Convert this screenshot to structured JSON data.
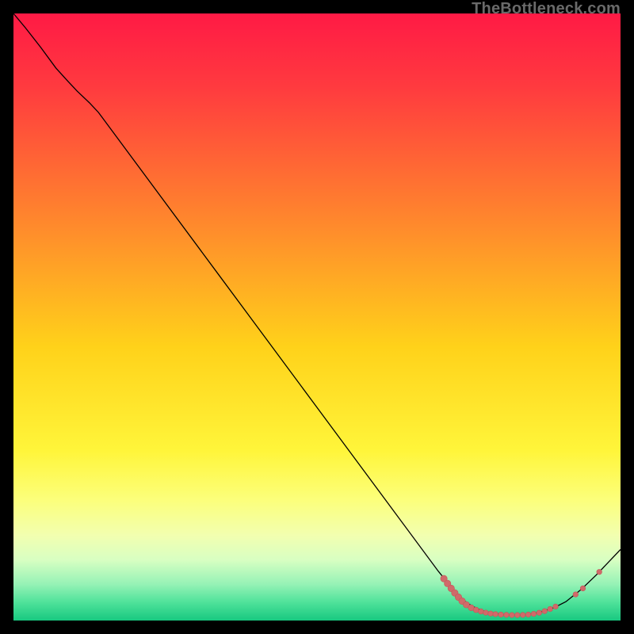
{
  "watermark": "TheBottleneck.com",
  "chart_data": {
    "type": "line",
    "title": "",
    "xlabel": "",
    "ylabel": "",
    "xlim": [
      0,
      100
    ],
    "ylim": [
      0,
      100
    ],
    "background_gradient": {
      "stops": [
        {
          "offset": 0.0,
          "color": "#ff1a45"
        },
        {
          "offset": 0.12,
          "color": "#ff3a3f"
        },
        {
          "offset": 0.35,
          "color": "#ff8a2c"
        },
        {
          "offset": 0.55,
          "color": "#ffd21a"
        },
        {
          "offset": 0.72,
          "color": "#fff53a"
        },
        {
          "offset": 0.8,
          "color": "#fcff7a"
        },
        {
          "offset": 0.86,
          "color": "#f2ffb0"
        },
        {
          "offset": 0.9,
          "color": "#d8ffc2"
        },
        {
          "offset": 0.94,
          "color": "#96f2b6"
        },
        {
          "offset": 0.97,
          "color": "#4fe29a"
        },
        {
          "offset": 1.0,
          "color": "#18c880"
        }
      ]
    },
    "series": [
      {
        "name": "curve",
        "color": "#000000",
        "width": 1.3,
        "points": [
          {
            "x": 0.0,
            "y": 100.0
          },
          {
            "x": 2.0,
            "y": 97.6
          },
          {
            "x": 4.5,
            "y": 94.4
          },
          {
            "x": 7.0,
            "y": 91.0
          },
          {
            "x": 9.0,
            "y": 88.8
          },
          {
            "x": 10.5,
            "y": 87.2
          },
          {
            "x": 12.5,
            "y": 85.3
          },
          {
            "x": 14.0,
            "y": 83.7
          },
          {
            "x": 34.0,
            "y": 56.7
          },
          {
            "x": 54.0,
            "y": 29.7
          },
          {
            "x": 70.0,
            "y": 8.1
          },
          {
            "x": 73.5,
            "y": 3.8
          },
          {
            "x": 75.5,
            "y": 2.4
          },
          {
            "x": 77.0,
            "y": 1.7
          },
          {
            "x": 79.0,
            "y": 1.15
          },
          {
            "x": 81.5,
            "y": 0.9
          },
          {
            "x": 84.0,
            "y": 0.9
          },
          {
            "x": 86.5,
            "y": 1.3
          },
          {
            "x": 89.0,
            "y": 2.1
          },
          {
            "x": 91.0,
            "y": 3.1
          },
          {
            "x": 93.5,
            "y": 5.1
          },
          {
            "x": 96.0,
            "y": 7.5
          },
          {
            "x": 98.0,
            "y": 9.6
          },
          {
            "x": 100.0,
            "y": 11.7
          }
        ]
      }
    ],
    "markers": {
      "color": "#d06a6a",
      "stroke": "#c45858",
      "points": [
        {
          "x": 70.9,
          "y": 6.9,
          "r": 4.2
        },
        {
          "x": 71.5,
          "y": 6.1,
          "r": 4.2
        },
        {
          "x": 72.1,
          "y": 5.3,
          "r": 4.2
        },
        {
          "x": 72.7,
          "y": 4.55,
          "r": 4.2
        },
        {
          "x": 73.3,
          "y": 3.85,
          "r": 4.2
        },
        {
          "x": 73.9,
          "y": 3.2,
          "r": 4.2
        },
        {
          "x": 74.6,
          "y": 2.6,
          "r": 4.0
        },
        {
          "x": 75.4,
          "y": 2.1,
          "r": 3.8
        },
        {
          "x": 76.2,
          "y": 1.75,
          "r": 3.5
        },
        {
          "x": 77.0,
          "y": 1.5,
          "r": 3.4
        },
        {
          "x": 77.8,
          "y": 1.3,
          "r": 3.3
        },
        {
          "x": 78.6,
          "y": 1.15,
          "r": 3.3
        },
        {
          "x": 79.4,
          "y": 1.05,
          "r": 3.3
        },
        {
          "x": 80.3,
          "y": 0.98,
          "r": 3.3
        },
        {
          "x": 81.2,
          "y": 0.93,
          "r": 3.3
        },
        {
          "x": 82.1,
          "y": 0.9,
          "r": 3.3
        },
        {
          "x": 83.0,
          "y": 0.9,
          "r": 3.3
        },
        {
          "x": 83.9,
          "y": 0.92,
          "r": 3.3
        },
        {
          "x": 84.8,
          "y": 0.98,
          "r": 3.3
        },
        {
          "x": 85.7,
          "y": 1.1,
          "r": 3.3
        },
        {
          "x": 86.6,
          "y": 1.28,
          "r": 3.3
        },
        {
          "x": 87.5,
          "y": 1.55,
          "r": 3.3
        },
        {
          "x": 88.4,
          "y": 1.9,
          "r": 3.3
        },
        {
          "x": 89.3,
          "y": 2.3,
          "r": 3.3
        },
        {
          "x": 92.6,
          "y": 4.3,
          "r": 3.3
        },
        {
          "x": 93.8,
          "y": 5.3,
          "r": 3.3
        },
        {
          "x": 96.5,
          "y": 8.0,
          "r": 3.3
        }
      ]
    }
  }
}
